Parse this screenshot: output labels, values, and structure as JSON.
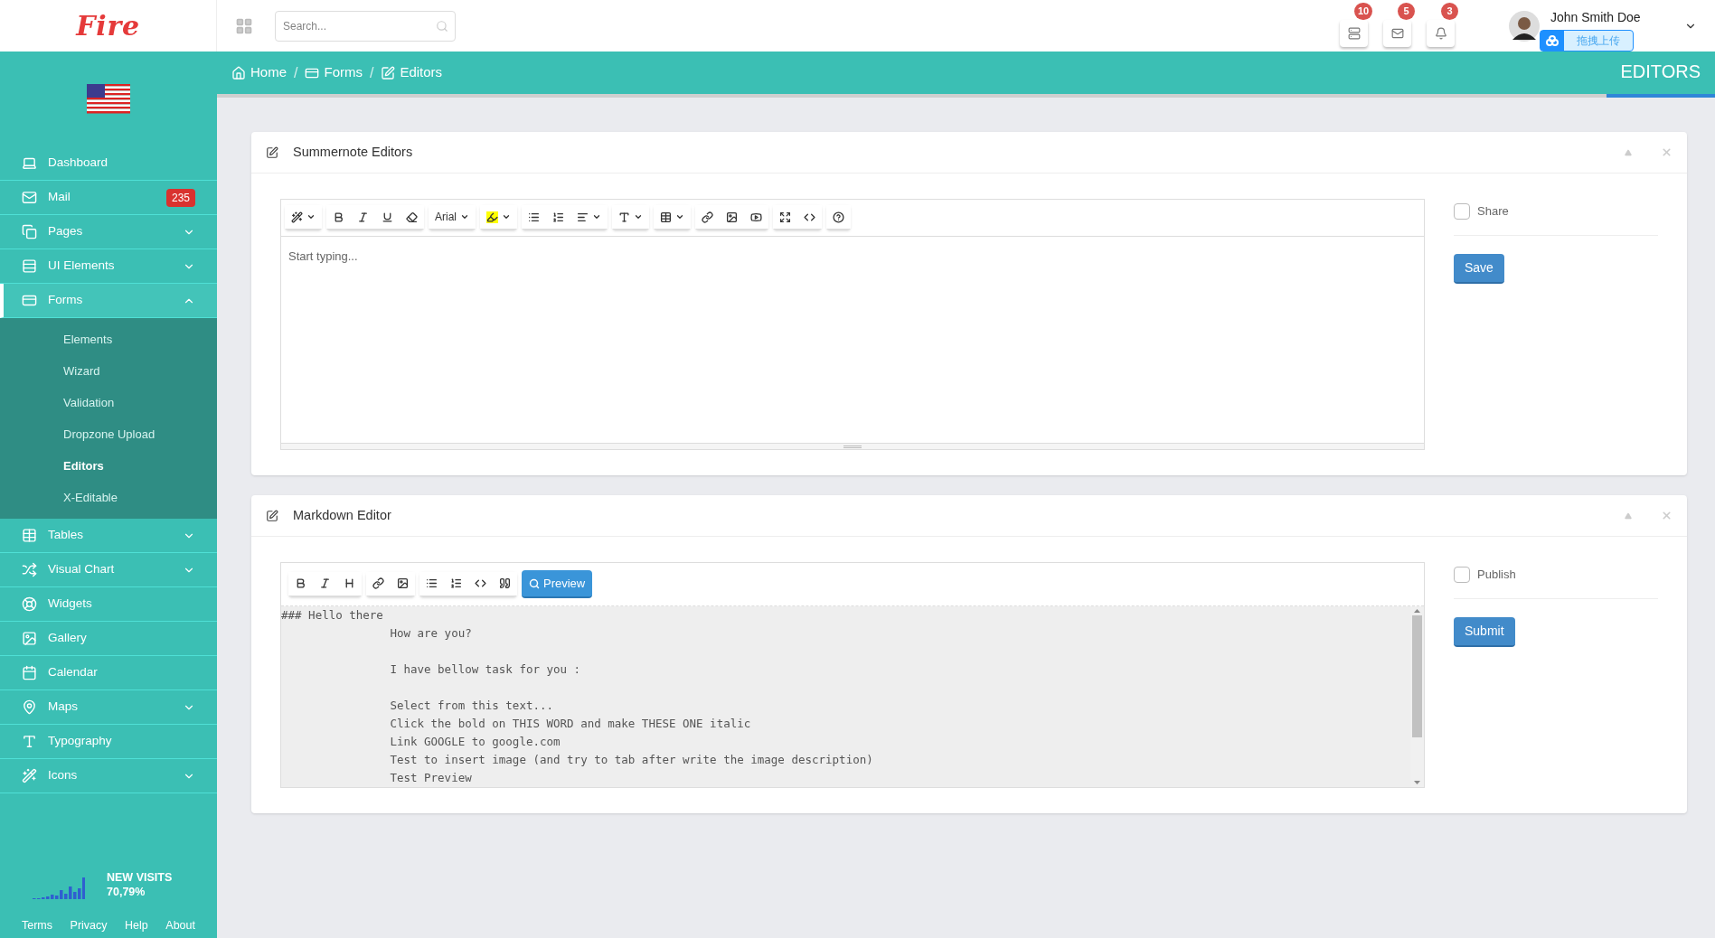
{
  "logo": "Fire",
  "search": {
    "placeholder": "Search..."
  },
  "header_buttons": [
    {
      "badge": "10"
    },
    {
      "badge": "5"
    },
    {
      "badge": "3"
    }
  ],
  "user": {
    "name": "John Smith Doe"
  },
  "upload_overlay": {
    "label": "拖拽上传"
  },
  "breadcrumb": [
    {
      "label": "Home"
    },
    {
      "label": "Forms"
    },
    {
      "label": "Editors"
    }
  ],
  "breadcrumb_separator": "/",
  "page_title": "EDITORS",
  "sidebar": {
    "items": [
      {
        "label": "Dashboard",
        "selected": false
      },
      {
        "label": "Mail",
        "badge": "235",
        "selected": false
      },
      {
        "label": "Pages",
        "expanded": false,
        "selected": false
      },
      {
        "label": "UI Elements",
        "expanded": false,
        "selected": false
      },
      {
        "label": "Forms",
        "expanded": true,
        "selected": true,
        "children": [
          {
            "label": "Elements",
            "selected": false
          },
          {
            "label": "Wizard",
            "selected": false
          },
          {
            "label": "Validation",
            "selected": false
          },
          {
            "label": "Dropzone Upload",
            "selected": false
          },
          {
            "label": "Editors",
            "selected": true
          },
          {
            "label": "X-Editable",
            "selected": false
          }
        ]
      },
      {
        "label": "Tables",
        "expanded": false,
        "selected": false
      },
      {
        "label": "Visual Chart",
        "expanded": false,
        "selected": false
      },
      {
        "label": "Widgets",
        "selected": false
      },
      {
        "label": "Gallery",
        "selected": false
      },
      {
        "label": "Calendar",
        "selected": false
      },
      {
        "label": "Maps",
        "expanded": false,
        "selected": false
      },
      {
        "label": "Typography",
        "selected": false
      },
      {
        "label": "Icons",
        "expanded": false,
        "selected": false
      }
    ],
    "stat": {
      "title": "NEW VISITS",
      "value": "70,79%"
    },
    "footer_links": [
      "Terms",
      "Privacy",
      "Help",
      "About"
    ]
  },
  "panels": [
    {
      "kind": "summernote",
      "title": "Summernote Editors",
      "font": "Arial",
      "placeholder": "Start typing...",
      "checkbox": {
        "label": "Share",
        "checked": false
      },
      "button": "Save"
    },
    {
      "kind": "markdown",
      "title": "Markdown Editor",
      "preview_button": "Preview",
      "value": "### Hello there\n                How are you?\n\n                I have bellow task for you :\n\n                Select from this text...\n                Click the bold on THIS WORD and make THESE ONE italic\n                Link GOOGLE to google.com\n                Test to insert image (and try to tab after write the image description)\n                Test Preview",
      "checkbox": {
        "label": "Publish",
        "checked": false
      },
      "button": "Submit"
    }
  ]
}
